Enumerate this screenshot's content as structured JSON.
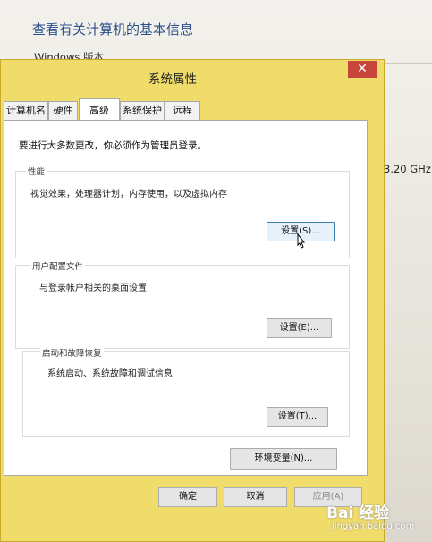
{
  "background": {
    "title": "查看有关计算机的基本信息",
    "windows_edition": "Windows 版本",
    "cpu_speed": "3.20 GHz"
  },
  "dialog": {
    "title": "系统属性",
    "close_glyph": "✕",
    "tabs": [
      {
        "label": "计算机名"
      },
      {
        "label": "硬件"
      },
      {
        "label": "高级"
      },
      {
        "label": "系统保护"
      },
      {
        "label": "远程"
      }
    ],
    "admin_note": "要进行大多数更改，你必须作为管理员登录。",
    "performance": {
      "label": "性能",
      "desc": "视觉效果，处理器计划，内存使用，以及虚拟内存",
      "button": "设置(S)..."
    },
    "profiles": {
      "label": "用户配置文件",
      "desc": "与登录帐户相关的桌面设置",
      "button": "设置(E)..."
    },
    "startup": {
      "label": "启动和故障恢复",
      "desc": "系统启动、系统故障和调试信息",
      "button": "设置(T)..."
    },
    "env_button": "环境变量(N)...",
    "ok": "确定",
    "cancel": "取消",
    "apply": "应用(A)"
  },
  "watermark": {
    "logo": "Bai 经验",
    "url": "jingyan.baidu.com"
  }
}
